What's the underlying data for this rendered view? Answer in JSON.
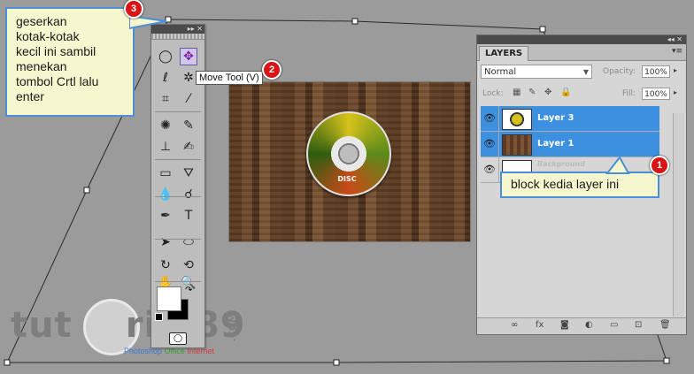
{
  "callouts": {
    "step3": {
      "number": "3",
      "text_lines": [
        "geserkan",
        "kotak-kotak",
        "kecil ini sambil",
        "menekan",
        "tombol Crtl lalu",
        "enter"
      ]
    },
    "step2": {
      "number": "2"
    },
    "step1": {
      "number": "1",
      "text": "block kedia layer ini"
    }
  },
  "tools_panel": {
    "collapse_label": "▸▸ ✕",
    "tooltip": "Move Tool (V)",
    "tools": [
      {
        "name": "marquee-tool",
        "icon": "◯"
      },
      {
        "name": "move-tool",
        "icon": "✥",
        "selected": true
      },
      {
        "name": "lasso-tool",
        "icon": "ℓ"
      },
      {
        "name": "magic-wand-tool",
        "icon": "✲"
      },
      {
        "name": "crop-tool",
        "icon": "⌗"
      },
      {
        "name": "eyedropper-tool",
        "icon": "⁄"
      },
      {
        "name": "healing-brush-tool",
        "icon": "✺"
      },
      {
        "name": "brush-tool",
        "icon": "✎"
      },
      {
        "name": "clone-stamp-tool",
        "icon": "⊥"
      },
      {
        "name": "history-brush-tool",
        "icon": "✍"
      },
      {
        "name": "eraser-tool",
        "icon": "▭"
      },
      {
        "name": "paint-bucket-tool",
        "icon": "⛛"
      },
      {
        "name": "blur-tool",
        "icon": "💧"
      },
      {
        "name": "dodge-tool",
        "icon": "☌"
      },
      {
        "name": "pen-tool",
        "icon": "✒"
      },
      {
        "name": "type-tool",
        "icon": "T"
      },
      {
        "name": "path-selection-tool",
        "icon": "➤"
      },
      {
        "name": "shape-tool",
        "icon": "⬭"
      },
      {
        "name": "3d-rotate-tool",
        "icon": "↻"
      },
      {
        "name": "3d-orbit-tool",
        "icon": "⟲"
      },
      {
        "name": "hand-tool",
        "icon": "✋"
      },
      {
        "name": "zoom-tool",
        "icon": "🔍"
      }
    ]
  },
  "disc": {
    "label": "DISC"
  },
  "layers_panel": {
    "title": "LAYERS",
    "collapse_label": "◂◂ ✕",
    "menu_icon": "▾≡",
    "blend_mode": "Normal",
    "opacity_label": "Opacity:",
    "opacity_value": "100%",
    "lock_label": "Lock:",
    "fill_label": "Fill:",
    "fill_value": "100%",
    "layers": [
      {
        "name": "Layer 3",
        "selected": true
      },
      {
        "name": "Layer 1",
        "selected": true
      },
      {
        "name": "Background",
        "selected": false
      }
    ],
    "footer_icons": [
      "link-icon",
      "fx-icon",
      "mask-icon",
      "adjustment-icon",
      "folder-icon",
      "new-layer-icon",
      "trash-icon"
    ]
  },
  "watermark": {
    "text_left": "tut",
    "text_right": "rial89",
    "sub_photoshop": "Photoshop",
    "sub_office": "Office",
    "sub_internet": "Internet",
    "com": ".COM"
  },
  "colors": {
    "callout_border": "#4c8fd6",
    "callout_fill": "#f6f6cf",
    "badge": "#d81414",
    "layer_selected": "#3d8fe0"
  }
}
